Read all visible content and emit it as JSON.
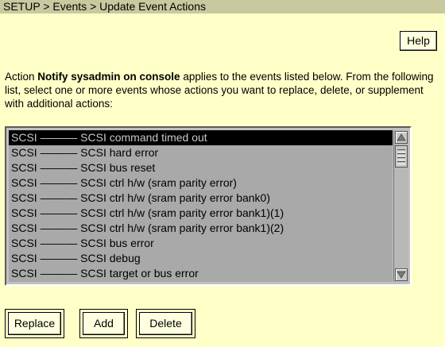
{
  "breadcrumb": "SETUP > Events > Update Event Actions",
  "help_label": "Help",
  "intro": {
    "prefix": "Action ",
    "action_name": "Notify sysadmin on console",
    "suffix": " applies to the events listed below. From the following list, select one or more events whose actions you want to replace, delete, or supplement with additional actions:"
  },
  "events": [
    "SCSI –––––– SCSI command timed out",
    "SCSI –––––– SCSI hard error",
    "SCSI –––––– SCSI bus reset",
    "SCSI –––––– SCSI ctrl h/w (sram parity error)",
    "SCSI –––––– SCSI ctrl h/w (sram parity error bank0)",
    "SCSI –––––– SCSI ctrl h/w (sram parity error bank1)(1)",
    "SCSI –––––– SCSI ctrl h/w (sram parity error bank1)(2)",
    "SCSI –––––– SCSI bus error",
    "SCSI –––––– SCSI debug",
    "SCSI –––––– SCSI target or bus error"
  ],
  "selected_index": 0,
  "buttons": {
    "replace": "Replace",
    "add": "Add",
    "delete": "Delete"
  },
  "colors": {
    "background": "#ffffc8",
    "titlebar": "#c9c9a0",
    "list_background": "#a9a9a9",
    "selected_row": "#000000"
  }
}
